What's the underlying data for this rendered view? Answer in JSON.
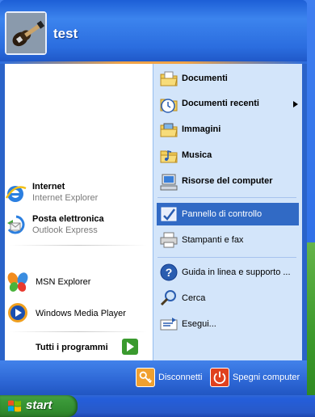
{
  "user": {
    "name": "test"
  },
  "left": {
    "pinned": [
      {
        "title": "Internet",
        "subtitle": "Internet Explorer",
        "icon": "internet-explorer-icon"
      },
      {
        "title": "Posta elettronica",
        "subtitle": "Outlook Express",
        "icon": "outlook-express-icon"
      }
    ],
    "recent": [
      {
        "title": "MSN Explorer",
        "icon": "msn-butterfly-icon"
      },
      {
        "title": "Windows Media Player",
        "icon": "media-player-icon"
      }
    ],
    "all_programs": "Tutti i programmi"
  },
  "right": {
    "items": [
      {
        "label": "Documenti",
        "icon": "documents-folder-icon",
        "bold": true
      },
      {
        "label": "Documenti recenti",
        "icon": "recent-documents-icon",
        "bold": true,
        "submenu": true
      },
      {
        "label": "Immagini",
        "icon": "pictures-folder-icon",
        "bold": true
      },
      {
        "label": "Musica",
        "icon": "music-folder-icon",
        "bold": true
      },
      {
        "label": "Risorse del computer",
        "icon": "my-computer-icon",
        "bold": true
      },
      {
        "label": "Pannello di controllo",
        "icon": "control-panel-icon",
        "bold": false,
        "selected": true
      },
      {
        "label": "Stampanti e fax",
        "icon": "printer-icon",
        "bold": false
      },
      {
        "label": "Guida in linea e supporto ...",
        "icon": "help-icon",
        "bold": false
      },
      {
        "label": "Cerca",
        "icon": "search-icon",
        "bold": false
      },
      {
        "label": "Esegui...",
        "icon": "run-icon",
        "bold": false
      }
    ]
  },
  "footer": {
    "logoff": "Disconnetti",
    "shutdown": "Spegni computer"
  },
  "taskbar": {
    "start_label": "start"
  },
  "colors": {
    "header_blue": "#2b6ddf",
    "right_pane": "#d3e5fa",
    "selection": "#316ac5",
    "start_green": "#3c9a3a"
  }
}
